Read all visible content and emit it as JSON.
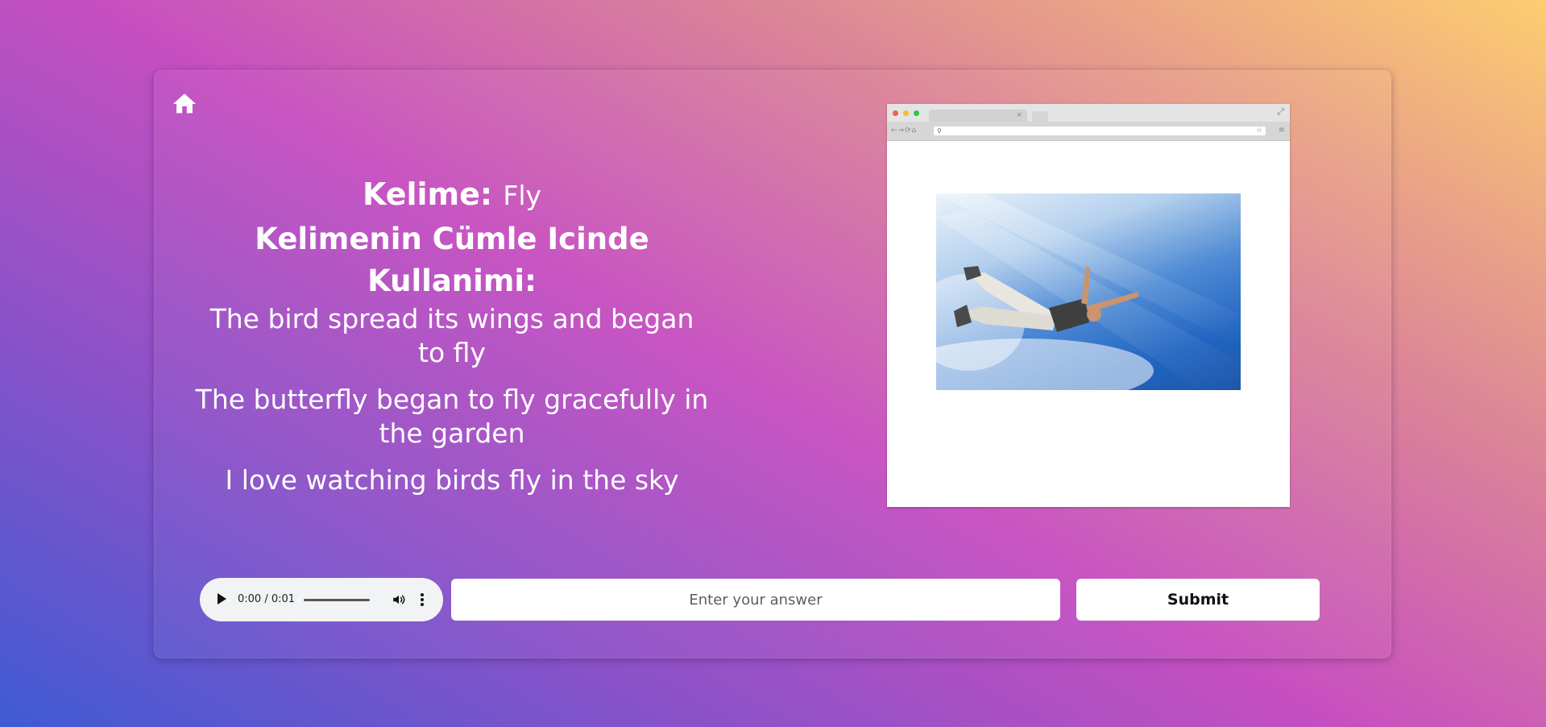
{
  "word": {
    "label": "Kelime:",
    "value": "Fly"
  },
  "usage": {
    "heading": "Kelimenin Cümle Icinde Kullanimi:",
    "sentences": [
      "The bird spread its wings and began to fly",
      "The butterfly began to fly gracefully in the garden",
      "I love watching birds fly in the sky"
    ]
  },
  "audio": {
    "time": "0:00 / 0:01",
    "progress": 0
  },
  "answer": {
    "placeholder": "Enter your answer",
    "value": ""
  },
  "submit": {
    "label": "Submit"
  },
  "icons": {
    "home": "home-icon",
    "play": "play-icon",
    "volume": "volume-icon",
    "more": "more-vert-icon"
  },
  "colors": {
    "gradient": [
      "#3f5bd4",
      "#c64fc0",
      "#dc8597",
      "#fccd70"
    ],
    "card_text": "#ffffff",
    "button_bg": "#ffffff"
  }
}
